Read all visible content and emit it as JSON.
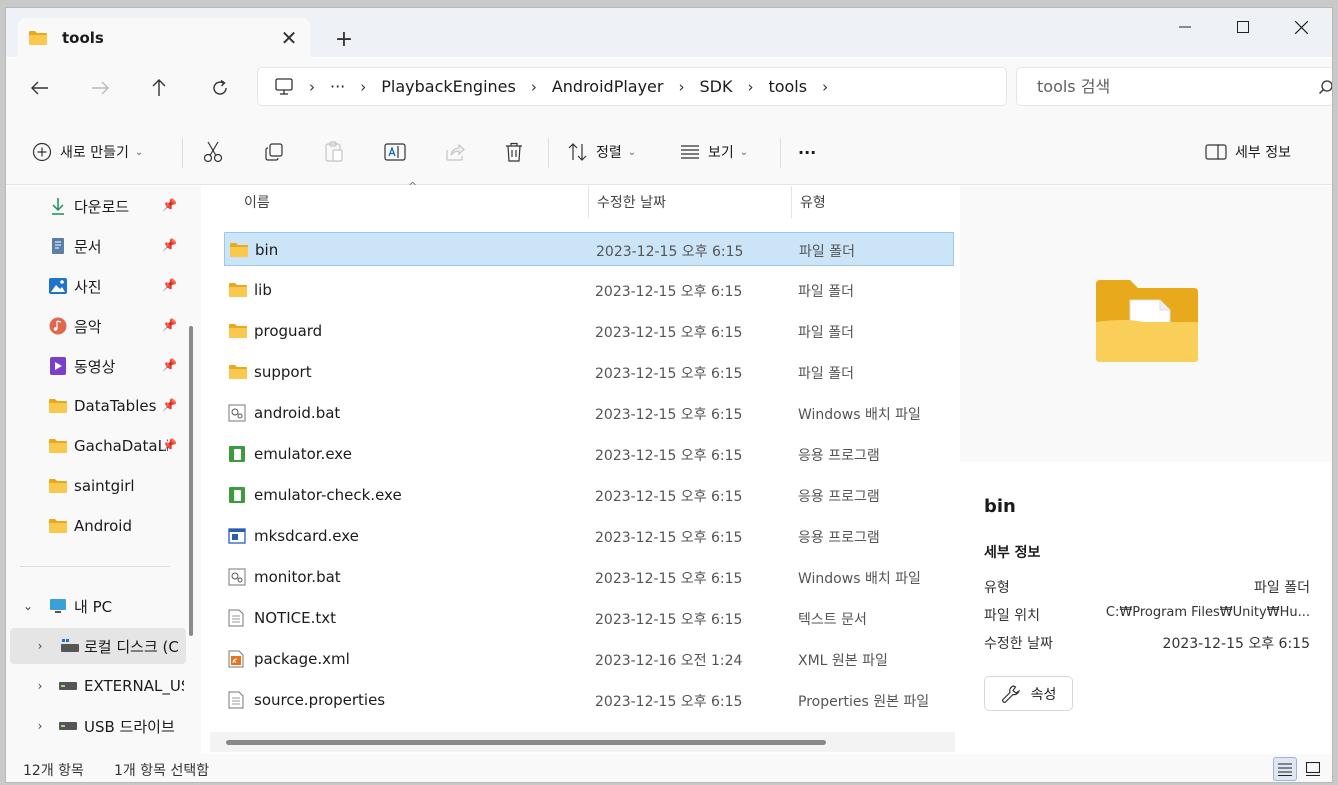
{
  "window": {
    "tab_title": "tools",
    "new_tab": "+"
  },
  "nav": {
    "breadcrumb": [
      "PlaybackEngines",
      "AndroidPlayer",
      "SDK",
      "tools"
    ],
    "overflow": "···",
    "search_placeholder": "tools 검색"
  },
  "commands": {
    "new": "새로 만들기",
    "sort": "정렬",
    "view": "보기",
    "more": "···",
    "details": "세부 정보"
  },
  "sidebar": {
    "quick_access": [
      {
        "label": "다운로드",
        "icon": "download-icon"
      },
      {
        "label": "문서",
        "icon": "document-icon"
      },
      {
        "label": "사진",
        "icon": "picture-icon"
      },
      {
        "label": "음악",
        "icon": "music-icon"
      },
      {
        "label": "동영상",
        "icon": "video-icon"
      },
      {
        "label": "DataTables",
        "icon": "folder-icon"
      },
      {
        "label": "GachaDataLi",
        "icon": "folder-icon"
      },
      {
        "label": "saintgirl",
        "icon": "folder-icon"
      },
      {
        "label": "Android",
        "icon": "folder-icon"
      }
    ],
    "this_pc": "내 PC",
    "drives": [
      "로컬 디스크 (C",
      "EXTERNAL_US",
      "USB 드라이브"
    ]
  },
  "columns": {
    "name": "이름",
    "date": "수정한 날짜",
    "type": "유형"
  },
  "files": [
    {
      "name": "bin",
      "date": "2023-12-15 오후 6:15",
      "type": "파일 폴더",
      "icon": "folder-icon"
    },
    {
      "name": "lib",
      "date": "2023-12-15 오후 6:15",
      "type": "파일 폴더",
      "icon": "folder-icon"
    },
    {
      "name": "proguard",
      "date": "2023-12-15 오후 6:15",
      "type": "파일 폴더",
      "icon": "folder-icon"
    },
    {
      "name": "support",
      "date": "2023-12-15 오후 6:15",
      "type": "파일 폴더",
      "icon": "folder-icon"
    },
    {
      "name": "android.bat",
      "date": "2023-12-15 오후 6:15",
      "type": "Windows 배치 파일",
      "icon": "batch-file-icon"
    },
    {
      "name": "emulator.exe",
      "date": "2023-12-15 오후 6:15",
      "type": "응용 프로그램",
      "icon": "exe-green-icon"
    },
    {
      "name": "emulator-check.exe",
      "date": "2023-12-15 오후 6:15",
      "type": "응용 프로그램",
      "icon": "exe-green-icon"
    },
    {
      "name": "mksdcard.exe",
      "date": "2023-12-15 오후 6:15",
      "type": "응용 프로그램",
      "icon": "exe-window-icon"
    },
    {
      "name": "monitor.bat",
      "date": "2023-12-15 오후 6:15",
      "type": "Windows 배치 파일",
      "icon": "batch-file-icon"
    },
    {
      "name": "NOTICE.txt",
      "date": "2023-12-15 오후 6:15",
      "type": "텍스트 문서",
      "icon": "text-file-icon"
    },
    {
      "name": "package.xml",
      "date": "2023-12-16 오전 1:24",
      "type": "XML 원본 파일",
      "icon": "xml-file-icon"
    },
    {
      "name": "source.properties",
      "date": "2023-12-15 오후 6:15",
      "type": "Properties 원본 파일",
      "icon": "text-file-icon"
    }
  ],
  "details": {
    "title": "bin",
    "section": "세부 정보",
    "type_key": "유형",
    "type_val": "파일 폴더",
    "location_key": "파일 위치",
    "location_val": "C:₩Program Files₩Unity₩Hu...",
    "modified_key": "수정한 날짜",
    "modified_val": "2023-12-15 오후 6:15",
    "properties_button": "속성"
  },
  "status": {
    "item_count": "12개 항목",
    "selected": "1개 항목 선택함"
  },
  "colors": {
    "selection": "#cce4f7",
    "accent": "#0067c0",
    "folder": "#f8c14a"
  }
}
